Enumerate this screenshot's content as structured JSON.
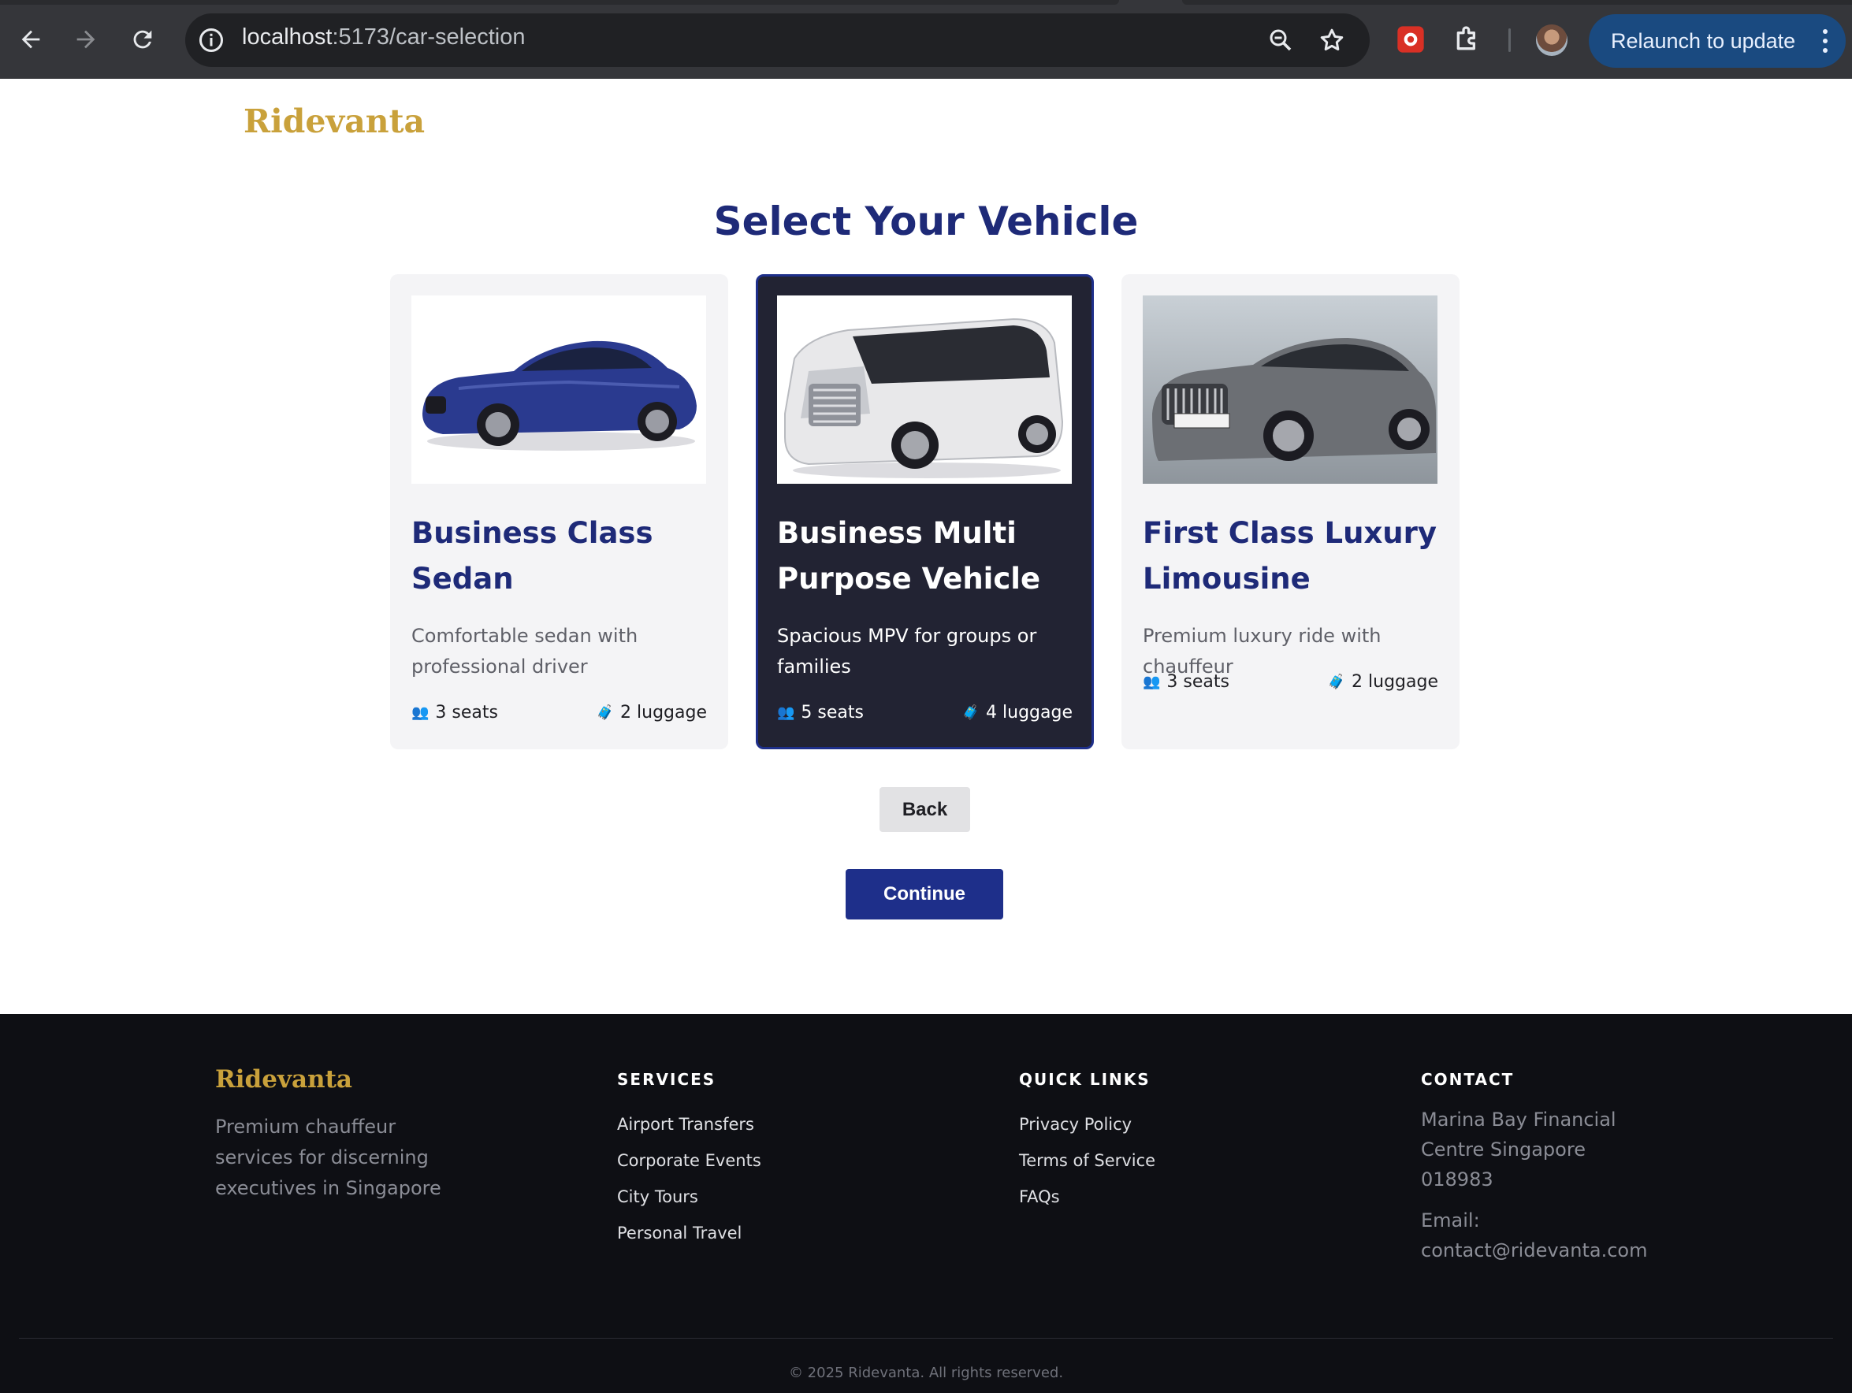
{
  "browser": {
    "url_host": "localhost",
    "url_path": ":5173/car-selection",
    "relaunch_label": "Relaunch to update",
    "icons": [
      "back-arrow-icon",
      "forward-arrow-icon",
      "reload-icon",
      "site-info-icon",
      "zoom-icon",
      "bookmark-star-icon",
      "extension-icon",
      "puzzle-extensions-icon",
      "profile-avatar",
      "kebab-menu-icon"
    ]
  },
  "header": {
    "brand": "Ridevanta"
  },
  "main": {
    "title": "Select Your Vehicle",
    "vehicles": [
      {
        "title": "Business Class Sedan",
        "description": "Comfortable sedan with professional driver",
        "seats": "3 seats",
        "luggage": "2 luggage",
        "selected": false,
        "color": "#2a3a8f"
      },
      {
        "title": "Business Multi Purpose Vehicle",
        "description": "Spacious MPV for groups or families",
        "seats": "5 seats",
        "luggage": "4 luggage",
        "selected": true,
        "color": "#e8e8ea"
      },
      {
        "title": "First Class Luxury Limousine",
        "description": "Premium luxury ride with chauffeur",
        "seats": "3 seats",
        "luggage": "2 luggage",
        "selected": false,
        "color": "#6c6f74"
      }
    ],
    "back_label": "Back",
    "continue_label": "Continue"
  },
  "footer": {
    "brand": "Ridevanta",
    "tagline": "Premium chauffeur services for discerning executives in Singapore",
    "services": {
      "heading": "SERVICES",
      "items": [
        "Airport Transfers",
        "Corporate Events",
        "City Tours",
        "Personal Travel"
      ]
    },
    "quick_links": {
      "heading": "QUICK LINKS",
      "items": [
        "Privacy Policy",
        "Terms of Service",
        "FAQs"
      ]
    },
    "contact": {
      "heading": "CONTACT",
      "address": "Marina Bay Financial Centre Singapore 018983",
      "email": "Email: contact@ridevanta.com"
    },
    "copyright": "© 2025 Ridevanta. All rights reserved."
  },
  "colors": {
    "brand_gold": "#c9a13b",
    "navy": "#1e2a78",
    "button_navy": "#1e2f8a",
    "footer_bg": "#0e0f14",
    "selected_card_bg": "#222333"
  }
}
